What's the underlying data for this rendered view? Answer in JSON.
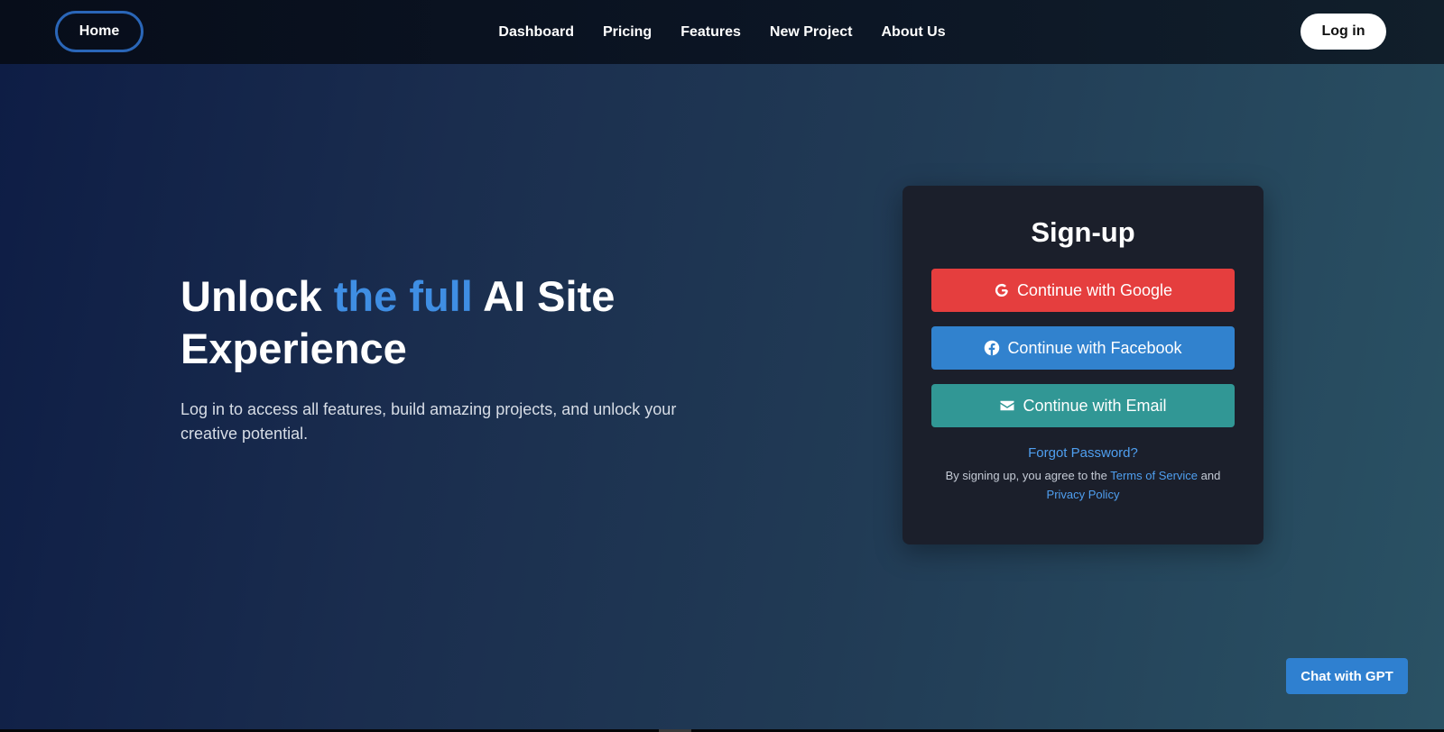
{
  "nav": {
    "home": "Home",
    "links": [
      "Dashboard",
      "Pricing",
      "Features",
      "New Project",
      "About Us"
    ],
    "login": "Log in"
  },
  "hero": {
    "headline_part1": "Unlock ",
    "headline_accent": "the full",
    "headline_part2": " AI Site Experience",
    "subtext": "Log in to access all features, build amazing projects, and unlock your creative potential."
  },
  "signup": {
    "title": "Sign-up",
    "google": "Continue with Google",
    "facebook": "Continue with Facebook",
    "email": "Continue with Email",
    "forgot": "Forgot Password?",
    "legal_prefix": "By signing up, you agree to the ",
    "terms": "Terms of Service",
    "legal_and": " and ",
    "privacy": "Privacy Policy"
  },
  "chat": {
    "label": "Chat with GPT"
  },
  "colors": {
    "accent": "#3f8ee3",
    "google": "#e53e3e",
    "facebook": "#3182ce",
    "email": "#319795"
  },
  "icons": {
    "google": "google-icon",
    "facebook": "facebook-icon",
    "email": "envelope-icon"
  }
}
